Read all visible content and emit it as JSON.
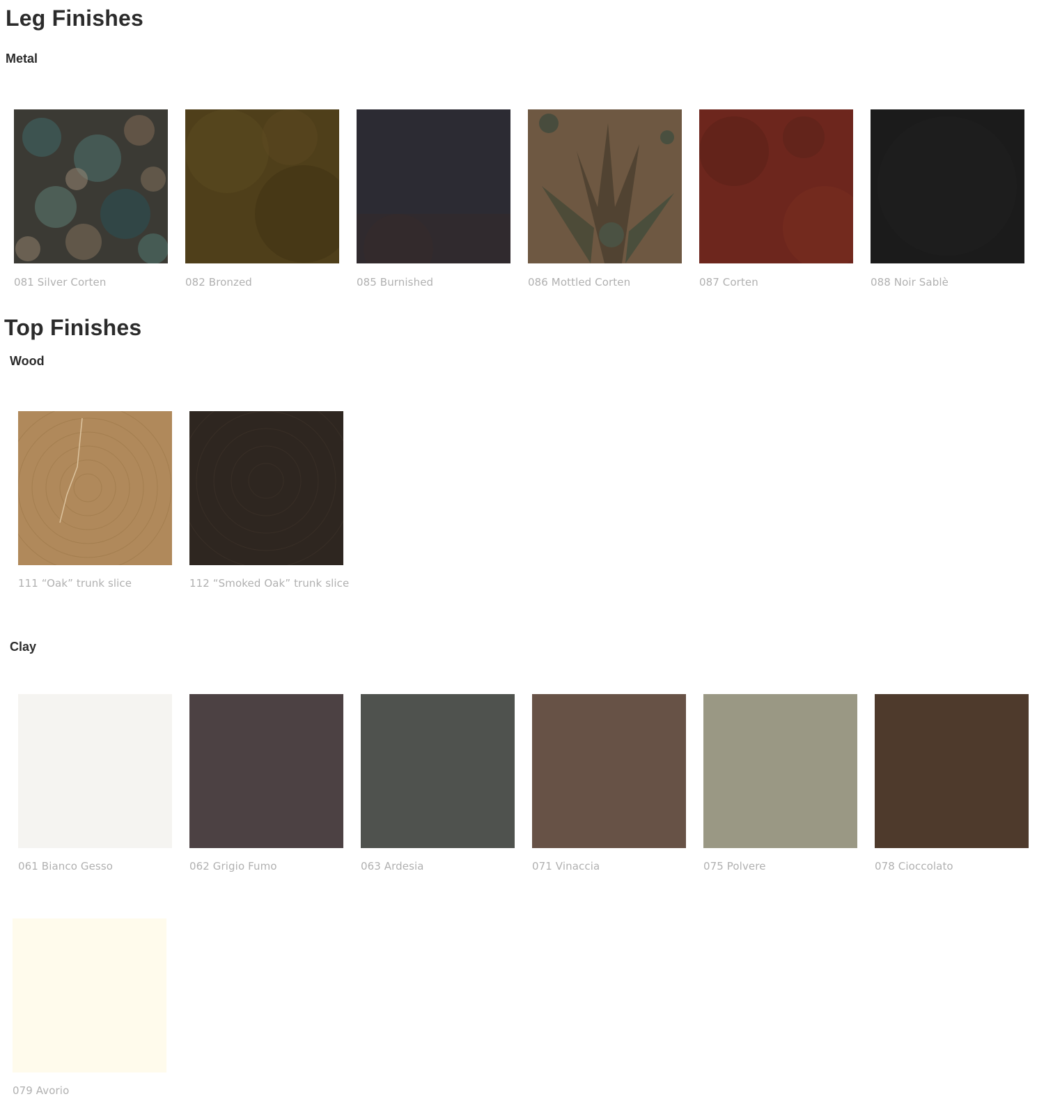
{
  "leg_finishes": {
    "title": "Leg Finishes",
    "metal": {
      "title": "Metal",
      "items": [
        {
          "label": "081 Silver Corten",
          "color": "#3b3a34"
        },
        {
          "label": "082 Bronzed",
          "color": "#4f3f1a"
        },
        {
          "label": "085 Burnished",
          "color": "#2c2b33"
        },
        {
          "label": "086 Mottled Corten",
          "color": "#6e5842"
        },
        {
          "label": "087 Corten",
          "color": "#6d261d"
        },
        {
          "label": "088 Noir Sablè",
          "color": "#1b1b1b"
        }
      ]
    }
  },
  "top_finishes": {
    "title": "Top Finishes",
    "wood": {
      "title": "Wood",
      "items": [
        {
          "label": "111 “Oak” trunk slice",
          "color": "#b0895b"
        },
        {
          "label": "112 “Smoked Oak” trunk slice",
          "color": "#2e2620"
        }
      ]
    },
    "clay": {
      "title": "Clay",
      "items": [
        {
          "label": "061 Bianco Gesso",
          "color": "#f5f4f1"
        },
        {
          "label": "062 Grigio Fumo",
          "color": "#4c4143"
        },
        {
          "label": "063 Ardesia",
          "color": "#4f524e"
        },
        {
          "label": "071 Vinaccia",
          "color": "#675246"
        },
        {
          "label": "075 Polvere",
          "color": "#9a9884"
        },
        {
          "label": "078 Cioccolato",
          "color": "#4e3a2c"
        },
        {
          "label": "079 Avorio",
          "color": "#fffbec"
        }
      ]
    }
  }
}
